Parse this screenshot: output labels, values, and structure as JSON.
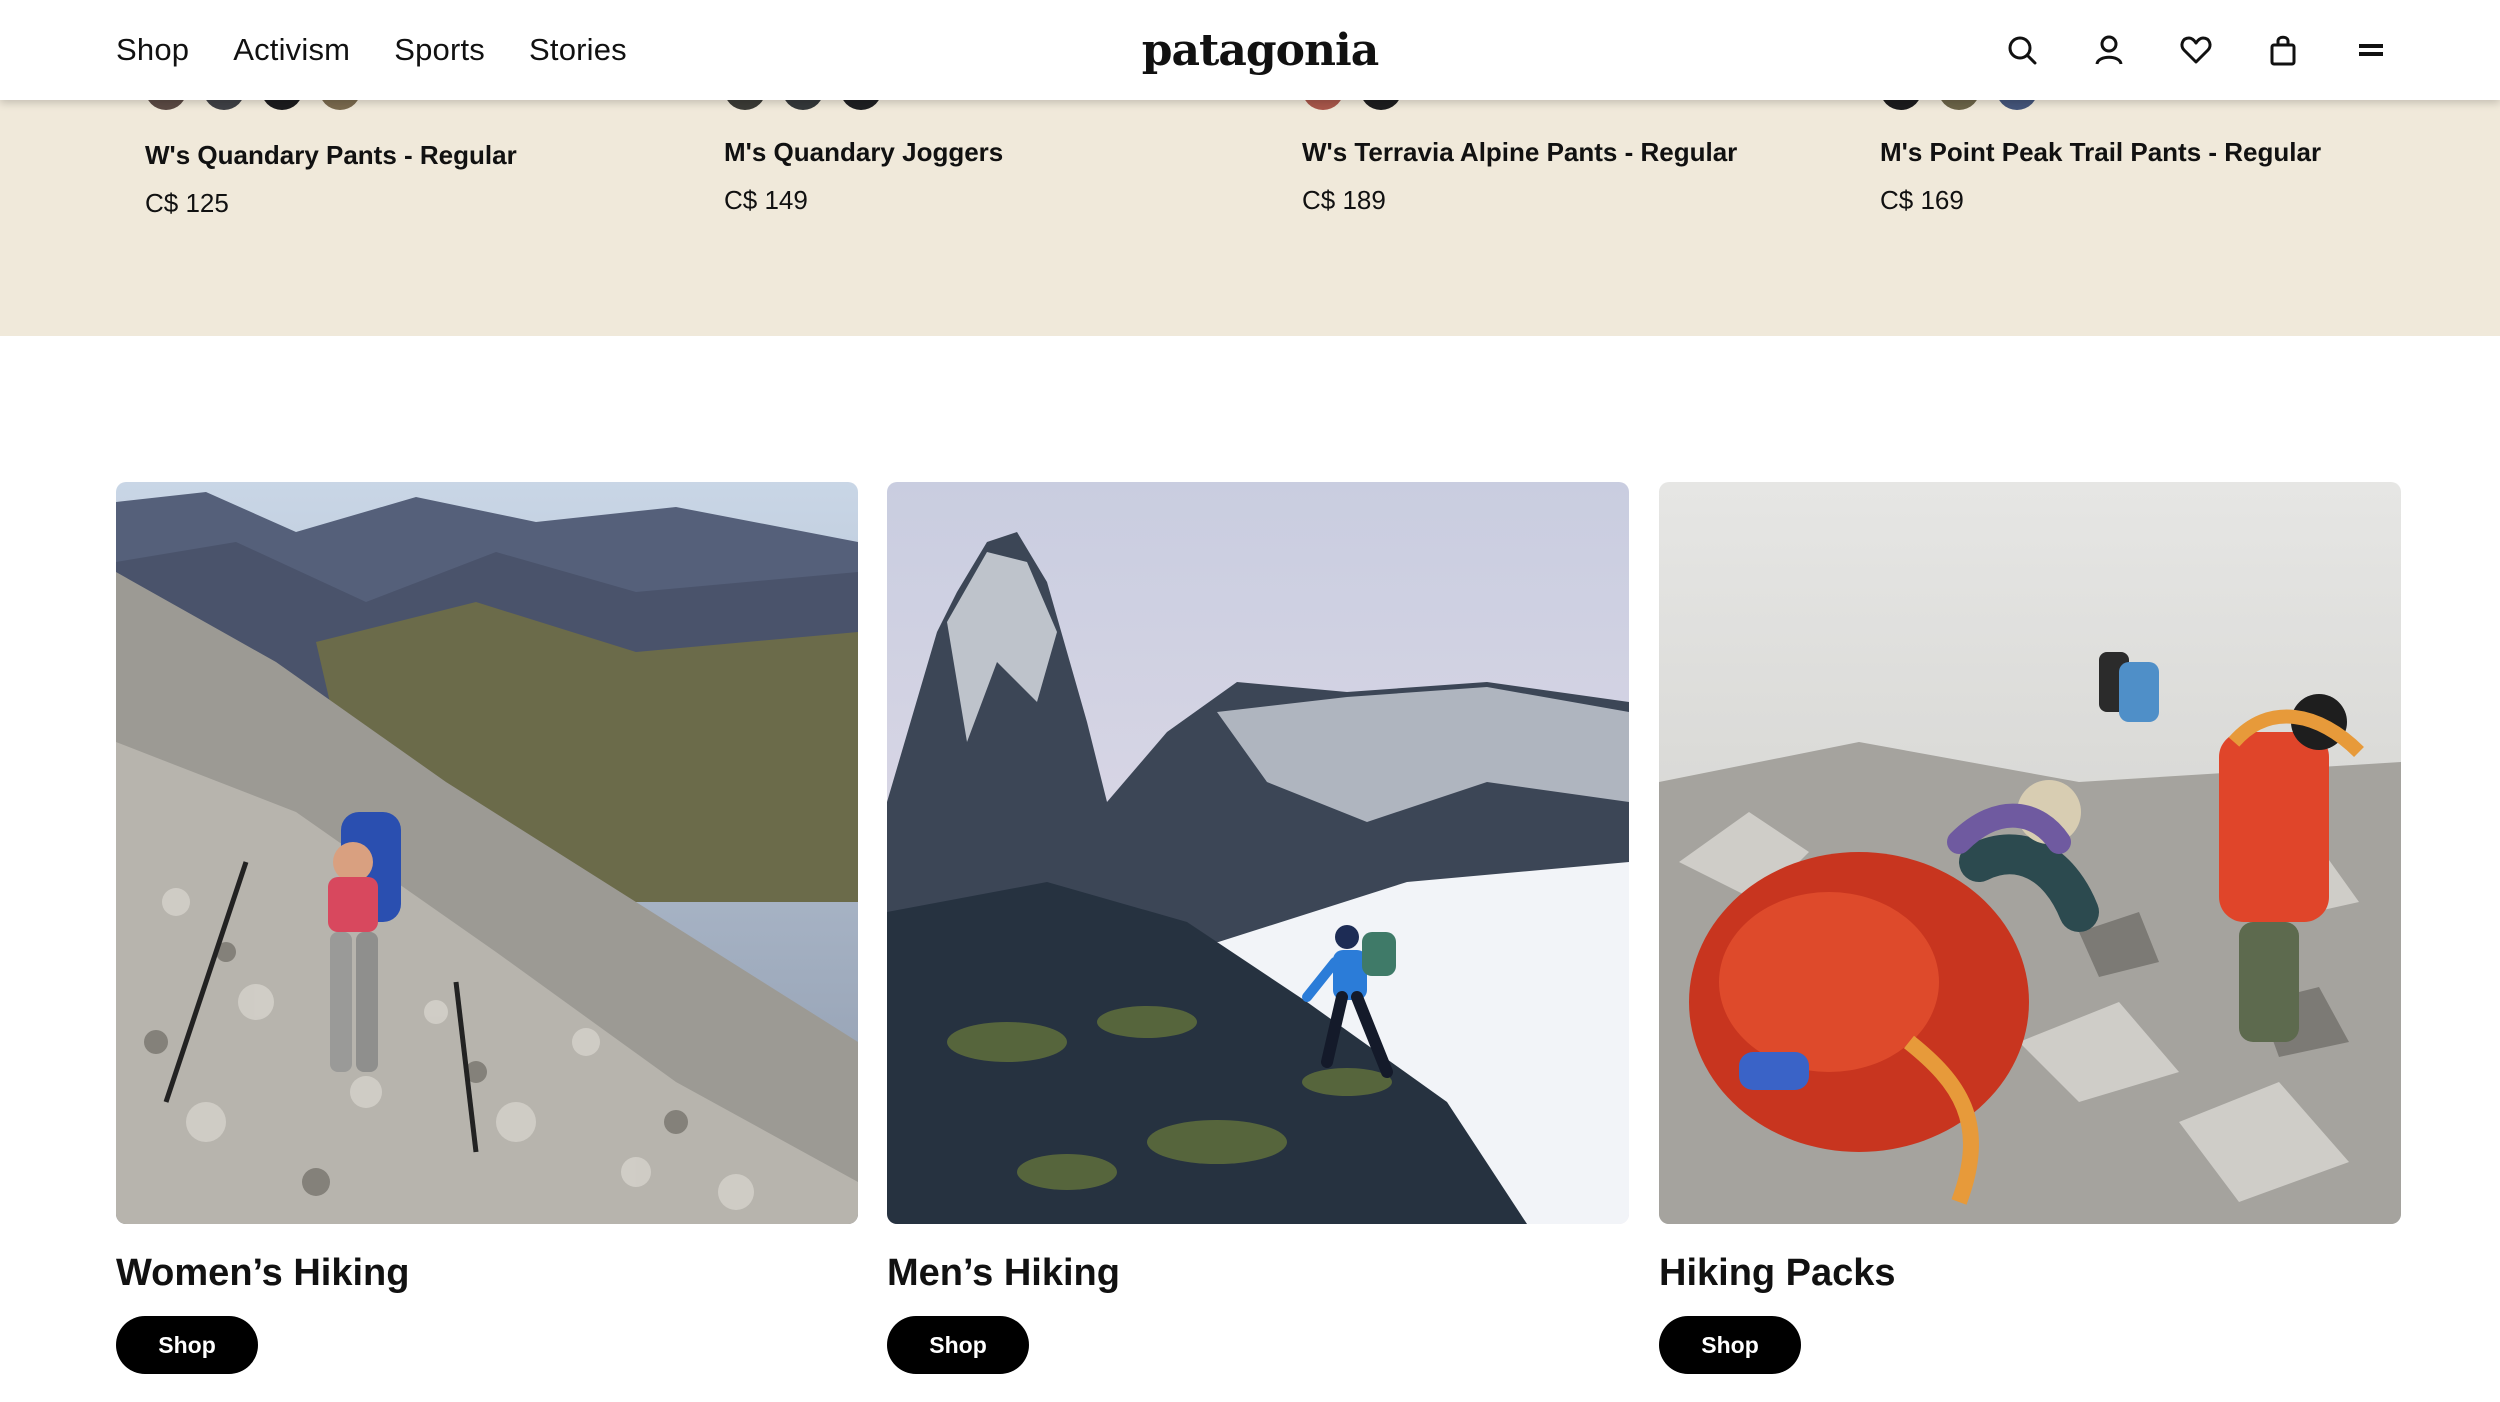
{
  "header": {
    "nav": [
      {
        "label": "Shop"
      },
      {
        "label": "Activism"
      },
      {
        "label": "Sports"
      },
      {
        "label": "Stories"
      }
    ],
    "logo_text": "patagonia",
    "icons": [
      "search-icon",
      "account-icon",
      "wishlist-heart-icon",
      "cart-bag-icon",
      "menu-icon"
    ]
  },
  "products": [
    {
      "name": "W's Quandary Pants - Regular",
      "price": "C$ 125",
      "swatches": [
        "#5b4a44",
        "#3f4146",
        "#1c1c1e",
        "#7a6a4e"
      ]
    },
    {
      "name": "M's Quandary Joggers",
      "price": "C$ 149",
      "swatches": [
        "#3b3b36",
        "#34383a",
        "#1e1f22"
      ]
    },
    {
      "name": "W's Terravia Alpine Pants - Regular",
      "price": "C$ 189",
      "swatches": [
        "#a9574b",
        "#1d1d1f"
      ]
    },
    {
      "name": "M's Point Peak Trail Pants - Regular",
      "price": "C$ 169",
      "swatches": [
        "#1b1b1d",
        "#6c6448",
        "#44557a"
      ]
    }
  ],
  "categories": [
    {
      "title": "Women’s Hiking",
      "button": "Shop"
    },
    {
      "title": "Men’s Hiking",
      "button": "Shop"
    },
    {
      "title": "Hiking Packs",
      "button": "Shop"
    }
  ],
  "colors": {
    "strip_background": "#f0e9da",
    "button_background": "#000000",
    "button_text": "#ffffff"
  }
}
